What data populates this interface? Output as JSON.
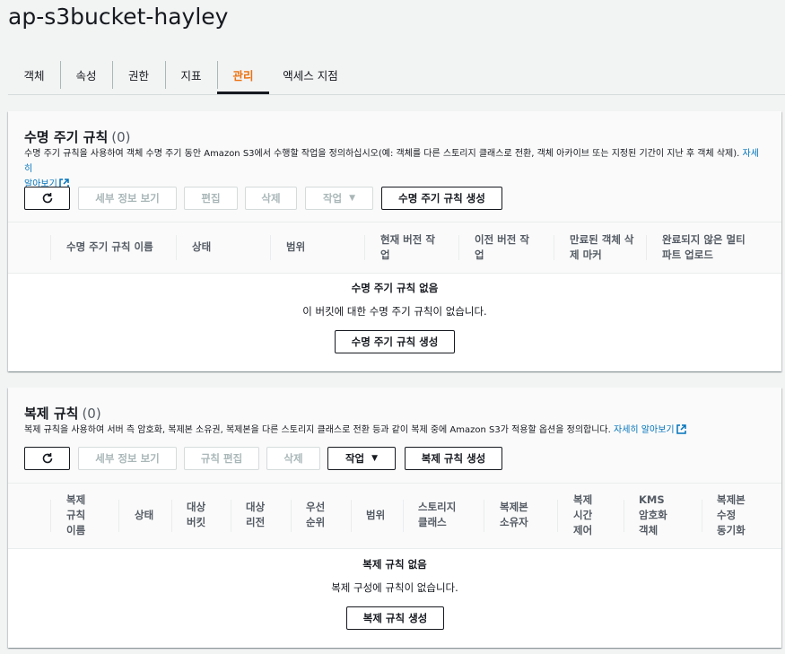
{
  "page": {
    "title": "ap-s3bucket-hayley"
  },
  "tabs": [
    {
      "label": "객체"
    },
    {
      "label": "속성"
    },
    {
      "label": "권한"
    },
    {
      "label": "지표"
    },
    {
      "label": "관리"
    },
    {
      "label": "액세스 지점"
    }
  ],
  "active_tab": "관리",
  "lifecycle": {
    "title": "수명 주기 규칙",
    "count": "(0)",
    "description": "수명 주기 규칙을 사용하여 객체 수명 주기 동안 Amazon S3에서 수행할 작업을 정의하십시오(예: 객체를 다른 스토리지 클래스로 전환, 객체 아카이브 또는 지정된 기간이 지난 후 객체 삭제).",
    "learn_more": "자세히",
    "learn_more_2": "알아보기",
    "buttons": {
      "details": "세부 정보 보기",
      "edit": "편집",
      "delete": "삭제",
      "actions": "작업",
      "create": "수명 주기 규칙 생성"
    },
    "columns": [
      "수명 주기 규칙 이름",
      "상태",
      "범위",
      "현재 버전 작\n업",
      "이전 버전 작\n업",
      "만료된 객체 삭\n제 마커",
      "완료되지 않은 멀티\n파트 업로드"
    ],
    "empty_title": "수명 주기 규칙 없음",
    "empty_text": "이 버킷에 대한 수명 주기 규칙이 없습니다.",
    "empty_button": "수명 주기 규칙 생성"
  },
  "replication": {
    "title": "복제 규칙",
    "count": "(0)",
    "description": "복제 규칙을 사용하여 서버 측 암호화, 복제본 소유권, 복제본을 다른 스토리지 클래스로 전환 등과 같이 복제 중에 Amazon S3가 적용할 옵션을 정의합니다.",
    "learn_more": "자세히 알아보기",
    "buttons": {
      "details": "세부 정보 보기",
      "edit": "규칙 편집",
      "delete": "삭제",
      "actions": "작업",
      "create": "복제 규칙 생성"
    },
    "columns": [
      "복제\n규칙\n이름",
      "상태",
      "대상\n버킷",
      "대상\n리전",
      "우선\n순위",
      "범위",
      "스토리지\n클래스",
      "복제본\n소유자",
      "복제\n시간\n제어",
      "KMS\n암호화\n객체",
      "복제본\n수정\n동기화"
    ],
    "empty_title": "복제 규칙 없음",
    "empty_text": "복제 구성에 규칙이 없습니다.",
    "empty_button": "복제 규칙 생성"
  }
}
